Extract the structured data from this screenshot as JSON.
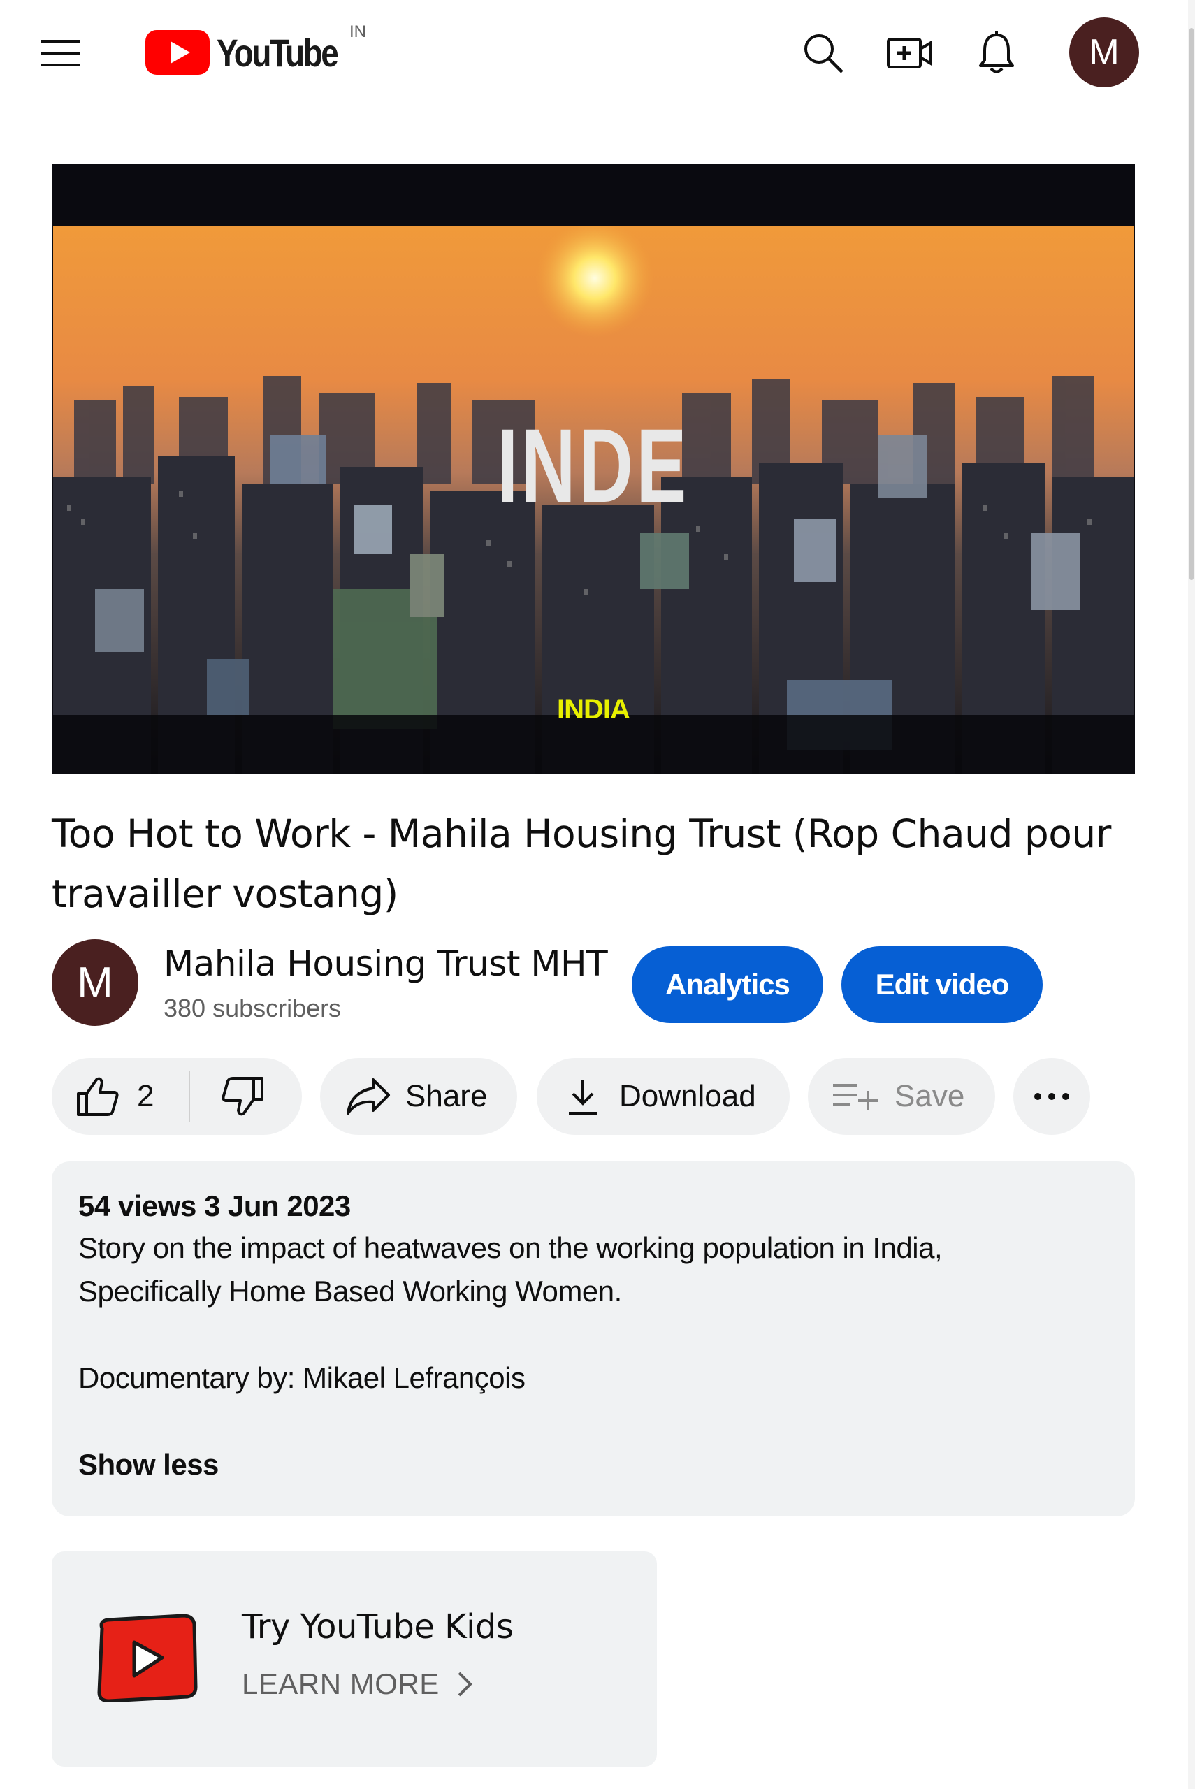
{
  "header": {
    "logo_text": "YouTube",
    "region": "IN",
    "icons": [
      "menu-icon",
      "search-icon",
      "create-icon",
      "bell-icon"
    ],
    "avatar_initial": "M"
  },
  "player": {
    "overlay_title": "INDE",
    "subtitle": "INDIA"
  },
  "video": {
    "title": "Too Hot to Work - Mahila Housing Trust (Rop Chaud pour travailler vostang)"
  },
  "channel": {
    "avatar_initial": "M",
    "name": "Mahila Housing Trust MHT",
    "subscribers": "380 subscribers",
    "analytics_label": "Analytics",
    "edit_label": "Edit video"
  },
  "actions": {
    "like_count": "2",
    "share_label": "Share",
    "download_label": "Download",
    "save_label": "Save",
    "more_icon": "more-horizontal-icon"
  },
  "description": {
    "meta": "54 views  3 Jun 2023",
    "line1": "Story on the impact of heatwaves on the working population in India,",
    "line2": "Specifically Home Based Working Women.",
    "line3": "Documentary by: Mikael Lefrançois",
    "toggle": "Show less"
  },
  "promo": {
    "title": "Try YouTube Kids",
    "cta": "LEARN MORE"
  },
  "colors": {
    "brand_red": "#ff0000",
    "accent_blue": "#065fd4",
    "surface": "#f0f2f3"
  }
}
